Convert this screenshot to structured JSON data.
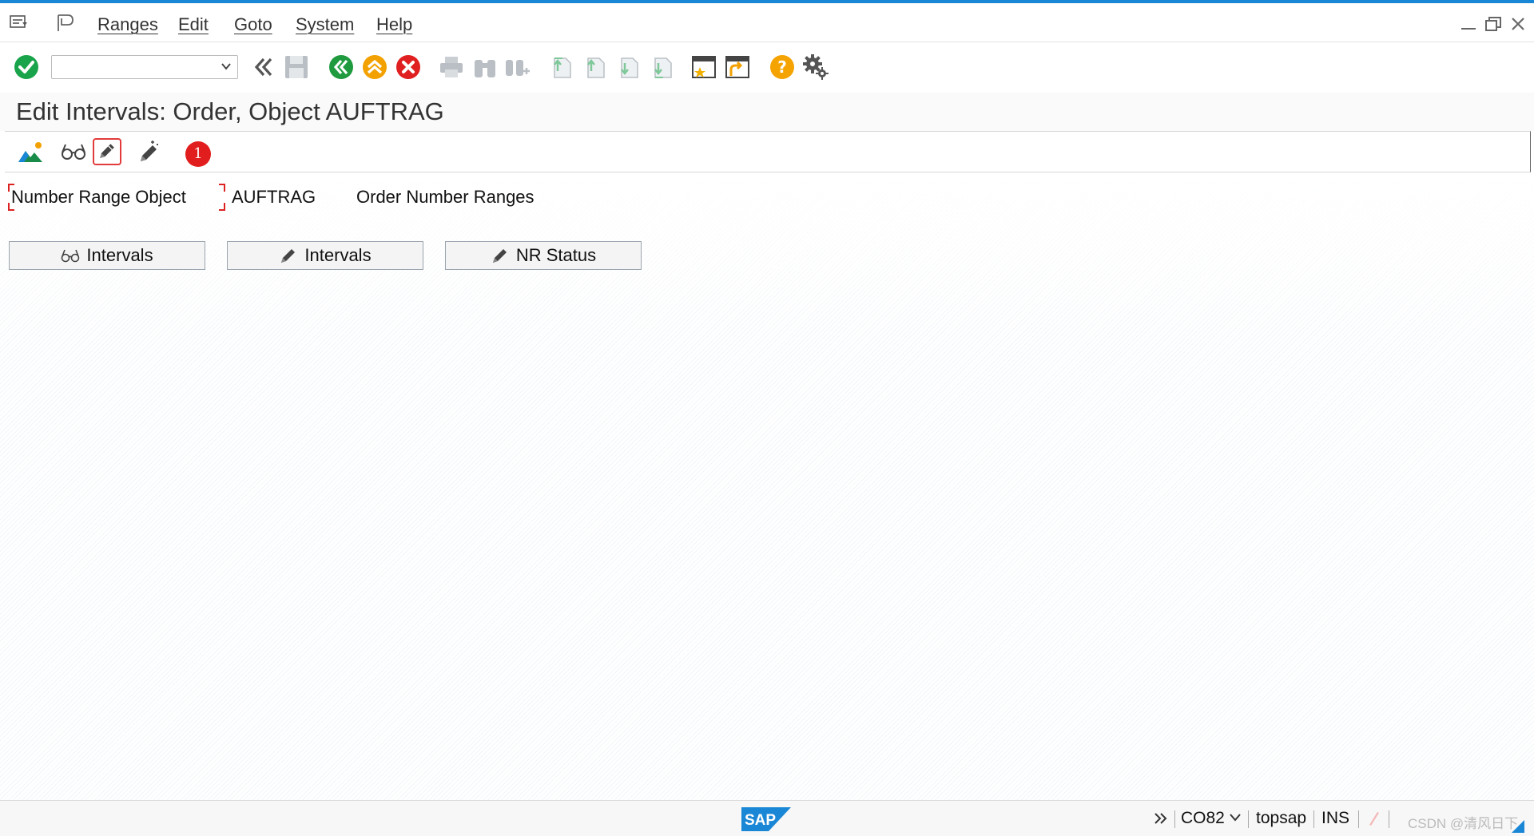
{
  "menu": {
    "items": [
      "Ranges",
      "Edit",
      "Goto",
      "System",
      "Help"
    ]
  },
  "toolbar": {
    "command_value": "",
    "command_placeholder": ""
  },
  "title": "Edit Intervals: Order, Object AUFTRAG",
  "app_toolbar": {
    "badge": "1"
  },
  "content": {
    "field_label": "Number Range Object",
    "field_value": "AUFTRAG",
    "field_description": "Order Number Ranges",
    "buttons": [
      "Intervals",
      "Intervals",
      "NR Status"
    ]
  },
  "status": {
    "transaction": "CO82",
    "server": "topsap",
    "mode": "INS",
    "watermark": "CSDN @清风日下"
  },
  "colors": {
    "accent_blue": "#1a87d6",
    "confirm_green": "#19a34a",
    "back_green": "#1f9a3f",
    "exit_orange": "#f2a100",
    "cancel_red": "#e02020",
    "help_orange": "#f5a300",
    "badge_red": "#e11d1d"
  }
}
